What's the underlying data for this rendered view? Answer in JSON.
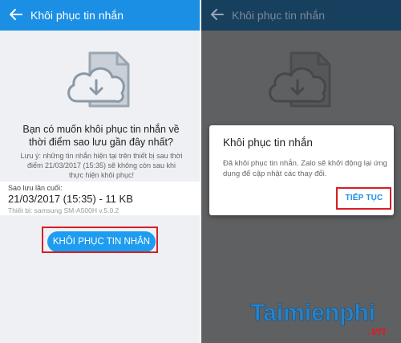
{
  "left_screen": {
    "header": {
      "title": "Khôi phục tin nhắn"
    },
    "question": "Bạn có muốn khôi phục tin nhắn về thời điểm sao lưu gần đây nhất?",
    "note": "Lưu ý: những tin nhắn hiện tại trên thiết bị sau thời điểm 21/03/2017 (15:35) sẽ không còn sau khi thực hiện khôi phục!",
    "backup": {
      "label": "Sao lưu lần cuối:",
      "value": "21/03/2017 (15:35) - 11 KB",
      "device": "Thiết bị: samsung SM-A500H v.5.0.2"
    },
    "restore_button": "KHÔI PHỤC TIN NHẮN"
  },
  "right_screen": {
    "header": {
      "title": "Khôi phục tin nhắn"
    },
    "dialog": {
      "title": "Khôi phục tin nhắn",
      "message": "Đã khôi phục tin nhắn. Zalo sẽ khởi động lại ứng dụng để cập nhật các thay đổi.",
      "continue_button": "TIẾP TỤC"
    }
  },
  "watermark": {
    "brand": "Taimienphi",
    "domain": ".vn"
  },
  "colors": {
    "accent_blue": "#1a8fe3",
    "button_blue": "#1d9cf0",
    "highlight_red": "#d42027",
    "background": "#eef0f3"
  },
  "icons": [
    "back-arrow-icon",
    "cloud-download-icon",
    "document-icon"
  ]
}
